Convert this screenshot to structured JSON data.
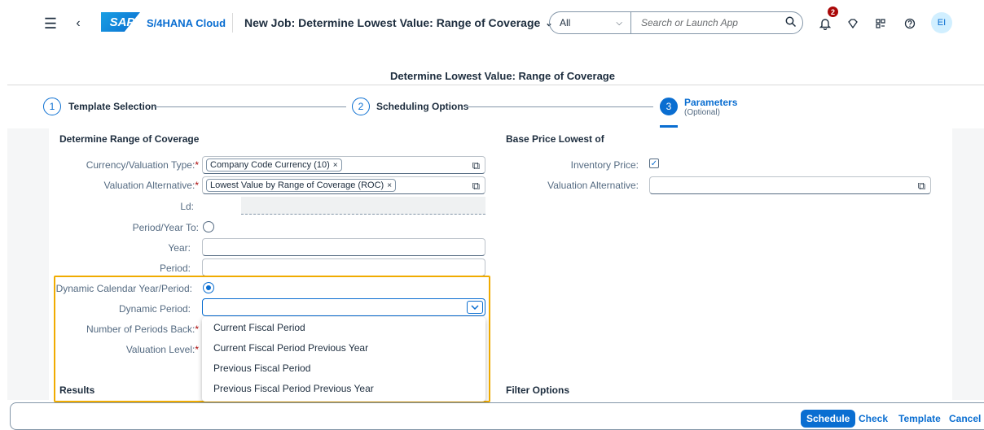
{
  "shell": {
    "logo": "SAP",
    "product": "S/4HANA Cloud",
    "app_title": "New Job: Determine Lowest Value: Range of Coverage",
    "search_scope": "All",
    "search_placeholder": "Search or Launch App",
    "notification_count": "2",
    "avatar_initials": "EI"
  },
  "page": {
    "title": "Determine Lowest Value: Range of Coverage"
  },
  "wizard": {
    "steps": [
      {
        "num": "1",
        "label": "Template Selection"
      },
      {
        "num": "2",
        "label": "Scheduling Options"
      },
      {
        "num": "3",
        "label": "Parameters",
        "sub": "(Optional)"
      }
    ]
  },
  "left_section": {
    "title": "Determine Range of Coverage",
    "currency_label": "Currency/Valuation Type:",
    "currency_token": "Company Code Currency (10)",
    "valalt_label": "Valuation Alternative:",
    "valalt_token": "Lowest Value by Range of Coverage (ROC)",
    "ld_label": "Ld:",
    "period_year_to_label": "Period/Year To:",
    "year_label": "Year:",
    "period_label": "Period:",
    "dyn_cal_label": "Dynamic Calendar Year/Period:",
    "dyn_period_label": "Dynamic Period:",
    "num_periods_label": "Number of Periods Back:",
    "val_level_label": "Valuation Level:",
    "results_title": "Results"
  },
  "right_section": {
    "title": "Base Price Lowest of",
    "inventory_price_label": "Inventory Price:",
    "valalt_label": "Valuation Alternative:",
    "filter_title": "Filter Options"
  },
  "dropdown": {
    "options": [
      "Current Fiscal Period",
      "Current Fiscal Period Previous Year",
      "Previous Fiscal Period",
      "Previous Fiscal Period Previous Year"
    ]
  },
  "footer": {
    "schedule": "Schedule",
    "check": "Check",
    "template": "Template",
    "cancel": "Cancel"
  },
  "icons": {
    "hamburger": "☰",
    "back": "‹",
    "chevron_down": "⌄",
    "search": "⌕",
    "bell": "🔔",
    "value_help": "⧉",
    "check": "✓",
    "remove": "×"
  }
}
